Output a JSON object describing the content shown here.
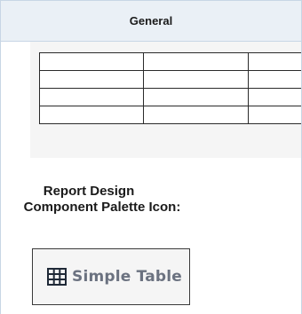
{
  "header": {
    "title": "General"
  },
  "preview": {
    "rows": 4,
    "columns": 3
  },
  "palette_section": {
    "line1": "Report Design",
    "line2": "Component Palette Icon:"
  },
  "palette_button": {
    "label": "Simple Table",
    "icon": "grid-table-icon",
    "text_color": "#6b7280"
  },
  "colors": {
    "header_bg": "#eaf0f6",
    "border": "#c8d6e5",
    "preview_bg": "#f5f5f5"
  }
}
